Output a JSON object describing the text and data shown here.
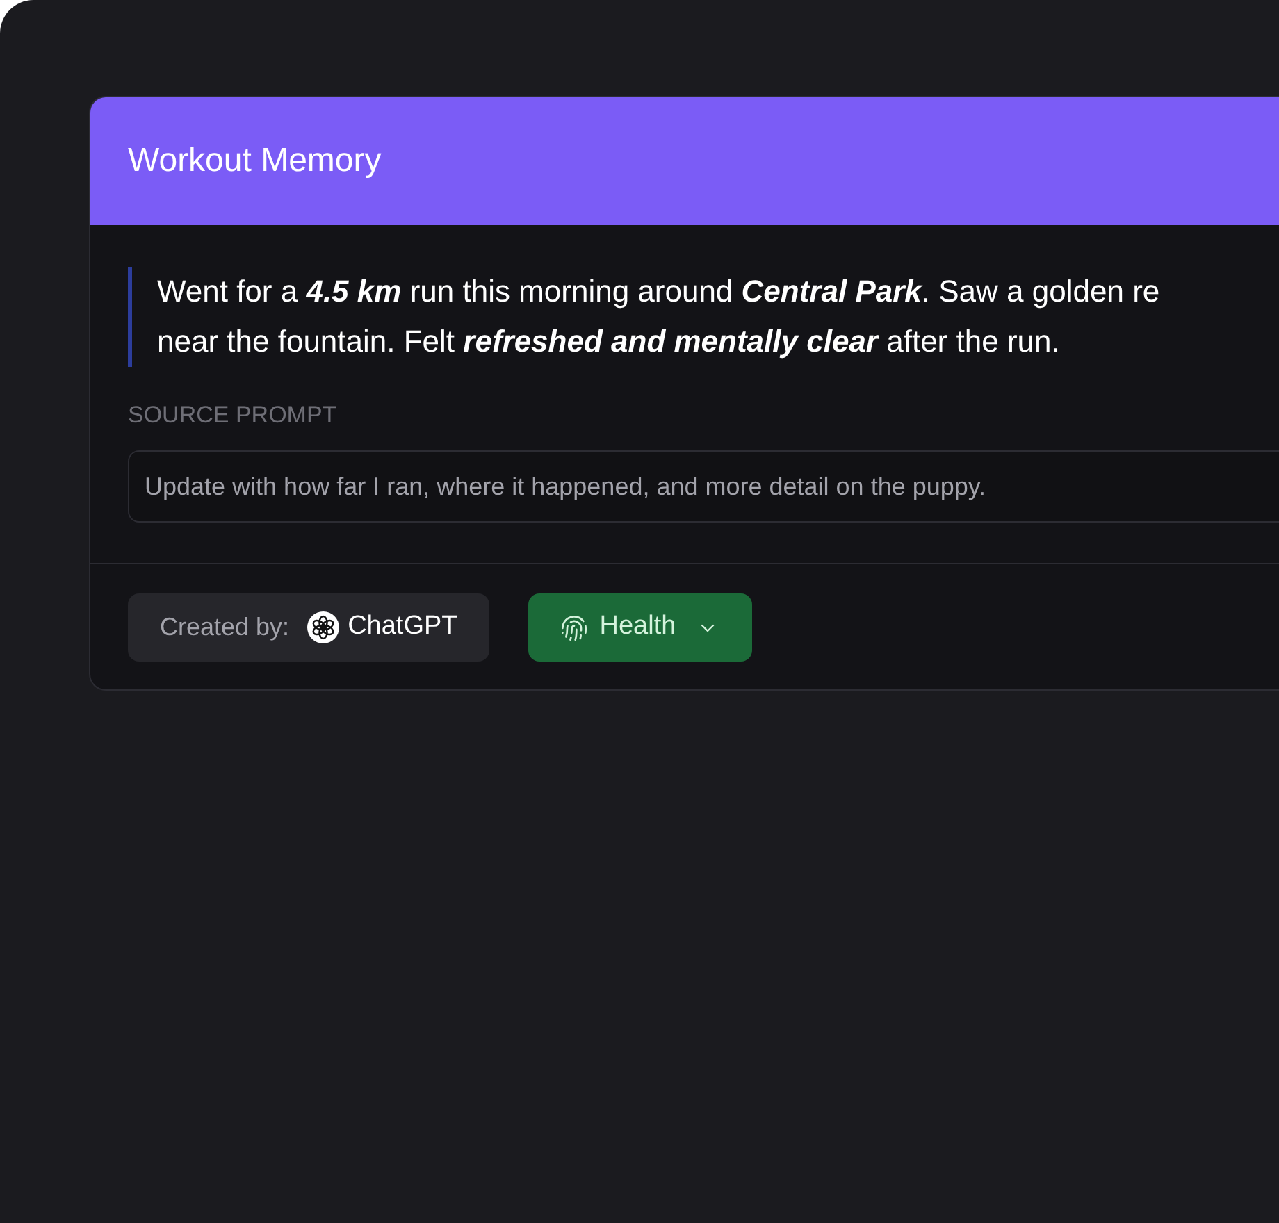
{
  "card": {
    "title": "Workout Memory",
    "memory_lines": [
      "Went for a **4.5 km** run this morning around **Central Park**. Saw a golden re",
      "near the fountain. Felt **refreshed and mentally clear** after the run."
    ],
    "source_prompt": {
      "label": "SOURCE PROMPT",
      "value": "Update with how far I ran, where it happened, and more detail on the puppy."
    },
    "created_by": {
      "label": "Created by:",
      "author": "ChatGPT"
    },
    "category": {
      "label": "Health"
    }
  }
}
